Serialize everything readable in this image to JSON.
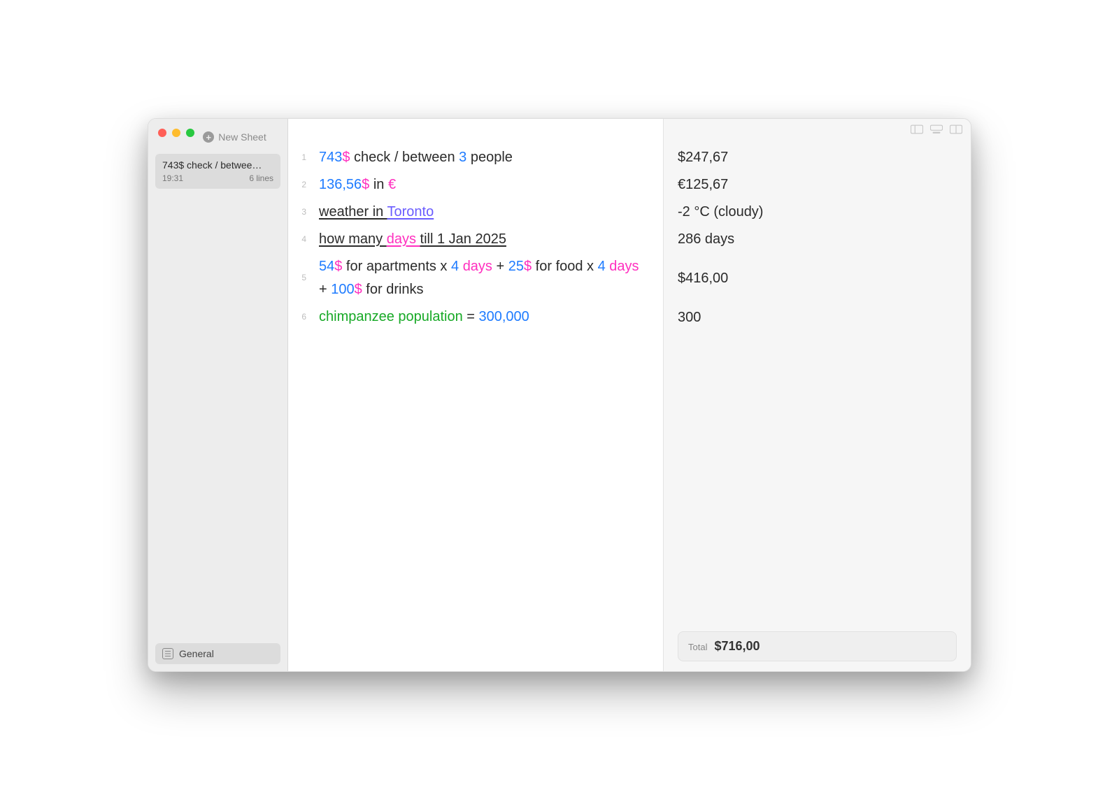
{
  "sidebar": {
    "new_sheet_label": "New Sheet",
    "sheet": {
      "title": "743$ check / betwee…",
      "time": "19:31",
      "lines": "6 lines"
    },
    "general_label": "General"
  },
  "lines": [
    {
      "n": "1",
      "tokens": [
        {
          "t": "743",
          "c": "num"
        },
        {
          "t": "$",
          "c": "unit"
        },
        {
          "t": " check / between ",
          "c": ""
        },
        {
          "t": "3",
          "c": "num"
        },
        {
          "t": " people",
          "c": ""
        }
      ],
      "result": "$247,67"
    },
    {
      "n": "2",
      "tokens": [
        {
          "t": "136,56",
          "c": "num"
        },
        {
          "t": "$",
          "c": "unit"
        },
        {
          "t": " in ",
          "c": ""
        },
        {
          "t": "€",
          "c": "unit"
        }
      ],
      "result": "€125,67"
    },
    {
      "n": "3",
      "tokens": [
        {
          "t": "weather in ",
          "c": "under"
        },
        {
          "t": "Toronto",
          "c": "link"
        }
      ],
      "result": "-2 °C (cloudy)"
    },
    {
      "n": "4",
      "tokens": [
        {
          "t": "how many ",
          "c": "under"
        },
        {
          "t": "days ",
          "c": "under-pink"
        },
        {
          "t": "till 1 Jan 2025",
          "c": "under"
        }
      ],
      "result": "286 days"
    },
    {
      "n": "5",
      "multi": true,
      "tokens": [
        {
          "t": "54",
          "c": "num"
        },
        {
          "t": "$",
          "c": "unit"
        },
        {
          "t": " for apartments x ",
          "c": ""
        },
        {
          "t": "4",
          "c": "num"
        },
        {
          "t": " ",
          "c": ""
        },
        {
          "t": "days",
          "c": "unit"
        },
        {
          "t": " + ",
          "c": ""
        },
        {
          "t": "25",
          "c": "num"
        },
        {
          "t": "$",
          "c": "unit"
        },
        {
          "t": " for food x ",
          "c": ""
        },
        {
          "t": "4",
          "c": "num"
        },
        {
          "t": " ",
          "c": ""
        },
        {
          "t": "days",
          "c": "unit"
        },
        {
          "t": " + ",
          "c": ""
        },
        {
          "t": "100",
          "c": "num"
        },
        {
          "t": "$",
          "c": "unit"
        },
        {
          "t": " for drinks",
          "c": ""
        }
      ],
      "result": "$416,00"
    },
    {
      "n": "6",
      "tokens": [
        {
          "t": "chimpanzee population",
          "c": "var"
        },
        {
          "t": " = ",
          "c": ""
        },
        {
          "t": "300,000",
          "c": "num"
        }
      ],
      "result": "300"
    }
  ],
  "total": {
    "label": "Total",
    "value": "$716,00"
  }
}
